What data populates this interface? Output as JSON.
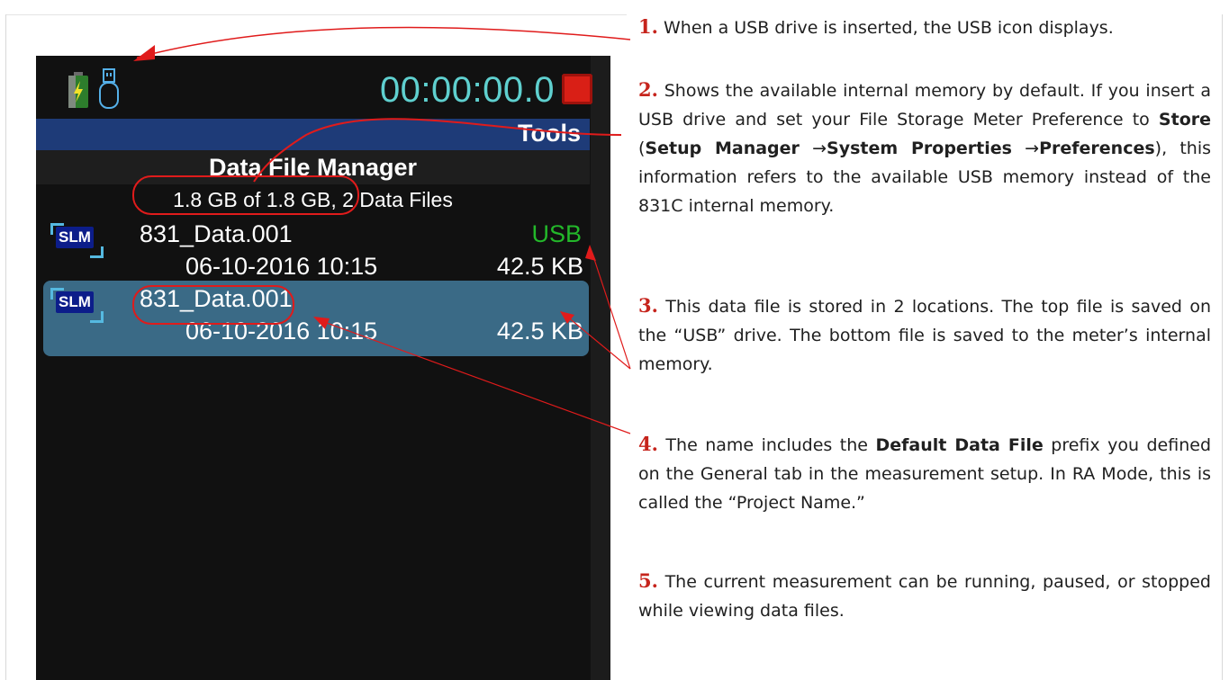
{
  "device": {
    "timer": "00:00:00.0",
    "tools_label": "Tools",
    "screen_title": "Data File Manager",
    "memory_info": "1.8 GB of 1.8 GB, 2 Data Files",
    "files": [
      {
        "badge": "SLM",
        "name": "831_Data.001",
        "location": "USB",
        "date": "06-10-2016 10:15",
        "size": "42.5 KB",
        "selected": false
      },
      {
        "badge": "SLM",
        "name": "831_Data.001",
        "location": "",
        "date": "06-10-2016 10:15",
        "size": "42.5 KB",
        "selected": true
      }
    ],
    "icons": {
      "battery": "battery-charging-icon",
      "usb": "usb-drive-icon",
      "stop": "stop-icon"
    },
    "colors": {
      "timer": "#5fd0cf",
      "tools_bar": "#1e3b78",
      "selected_row": "#3a6a86",
      "usb_text": "#23b82a",
      "stop": "#d91f16"
    }
  },
  "callouts": {
    "c1": {
      "num": "1.",
      "text": "When a USB drive is inserted, the USB icon displays."
    },
    "c2": {
      "num": "2.",
      "t1": "Shows the available internal memory by default. If you insert a USB drive and set your File Storage Meter Preference to ",
      "b1": "Store",
      "t2": " (",
      "b2": "Setup Manager",
      "t3": " →",
      "b3": "System Properties",
      "t4": " →",
      "b4": "Preferences",
      "t5": "), this information refers to the available USB memory instead of the 831C internal memory."
    },
    "c3": {
      "num": "3.",
      "text": "This data file is stored in 2 locations. The top file is saved on the “USB” drive. The bottom file is saved to the meter’s internal memory."
    },
    "c4": {
      "num": "4.",
      "t1": "The name includes the ",
      "b1": "Default Data File",
      "t2": " prefix you defined on the General tab in the measurement setup. In RA Mode, this is called the “Project Name.”"
    },
    "c5": {
      "num": "5.",
      "text": "The current measurement can be running, paused, or stopped while viewing data files."
    }
  }
}
